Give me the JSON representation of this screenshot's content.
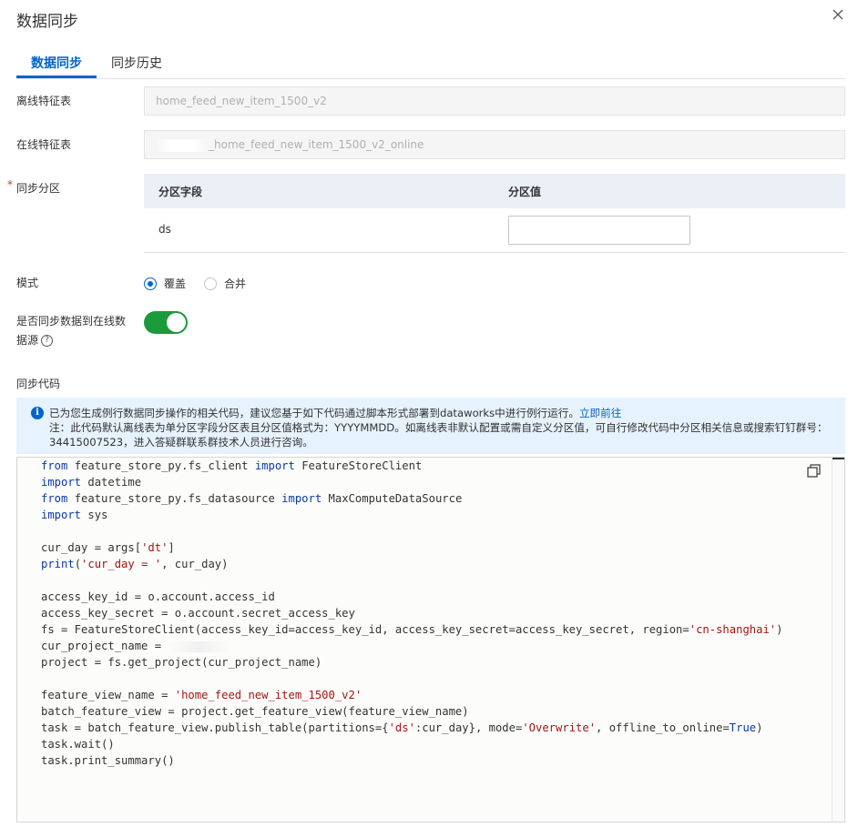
{
  "dialog": {
    "title": "数据同步"
  },
  "tabs": [
    {
      "label": "数据同步"
    },
    {
      "label": "同步历史"
    }
  ],
  "form": {
    "offline_table": {
      "label": "离线特征表",
      "value": "home_feed_new_item_1500_v2"
    },
    "online_table": {
      "label": "在线特征表",
      "value": "_home_feed_new_item_1500_v2_online"
    },
    "sync_partition": {
      "label": "同步分区",
      "required_mark": "*",
      "columns": [
        "分区字段",
        "分区值"
      ],
      "rows": [
        {
          "field": "ds",
          "value": ""
        }
      ]
    },
    "mode": {
      "label": "模式",
      "options": [
        {
          "label": "覆盖",
          "selected": true
        },
        {
          "label": "合并",
          "selected": false
        }
      ]
    },
    "sync_online": {
      "label_line1": "是否同步数据到在线数",
      "label_line2": "据源",
      "help": "?",
      "enabled": true
    },
    "sync_code": {
      "label": "同步代码"
    }
  },
  "notice": {
    "icon": "info-icon",
    "line1": "已为您生成例行数据同步操作的相关代码，建议您基于如下代码通过脚本形式部署到dataworks中进行例行运行。",
    "link": "立即前往",
    "line2": "注：此代码默认离线表为单分区字段分区表且分区值格式为：YYYYMMDD。如离线表非默认配置或需自定义分区值，可自行修改代码中分区相关信息或搜索钉钉群号：34415007523，进入答疑群联系群技术人员进行咨询。"
  },
  "code": {
    "copy_icon": "copy-icon",
    "lines": [
      "from feature_store_py.fs_client import FeatureStoreClient",
      "import datetime",
      "from feature_store_py.fs_datasource import MaxComputeDataSource",
      "import sys",
      "",
      "cur_day = args['dt']",
      "print('cur_day = ', cur_day)",
      "",
      "access_key_id = o.account.access_id",
      "access_key_secret = o.account.secret_access_key",
      "fs = FeatureStoreClient(access_key_id=access_key_id, access_key_secret=access_key_secret, region='cn-shanghai')",
      "cur_project_name = ",
      "project = fs.get_project(cur_project_name)",
      "",
      "feature_view_name = 'home_feed_new_item_1500_v2'",
      "batch_feature_view = project.get_feature_view(feature_view_name)",
      "task = batch_feature_view.publish_table(partitions={'ds':cur_day}, mode='Overwrite', offline_to_online=True)",
      "task.wait()",
      "task.print_summary()"
    ]
  },
  "colors": {
    "accent": "#0064c8",
    "toggle_on": "#1b9a3c",
    "notice_bg": "#e6f2fd",
    "keyword": "#0b3aa6",
    "string": "#a31515"
  }
}
